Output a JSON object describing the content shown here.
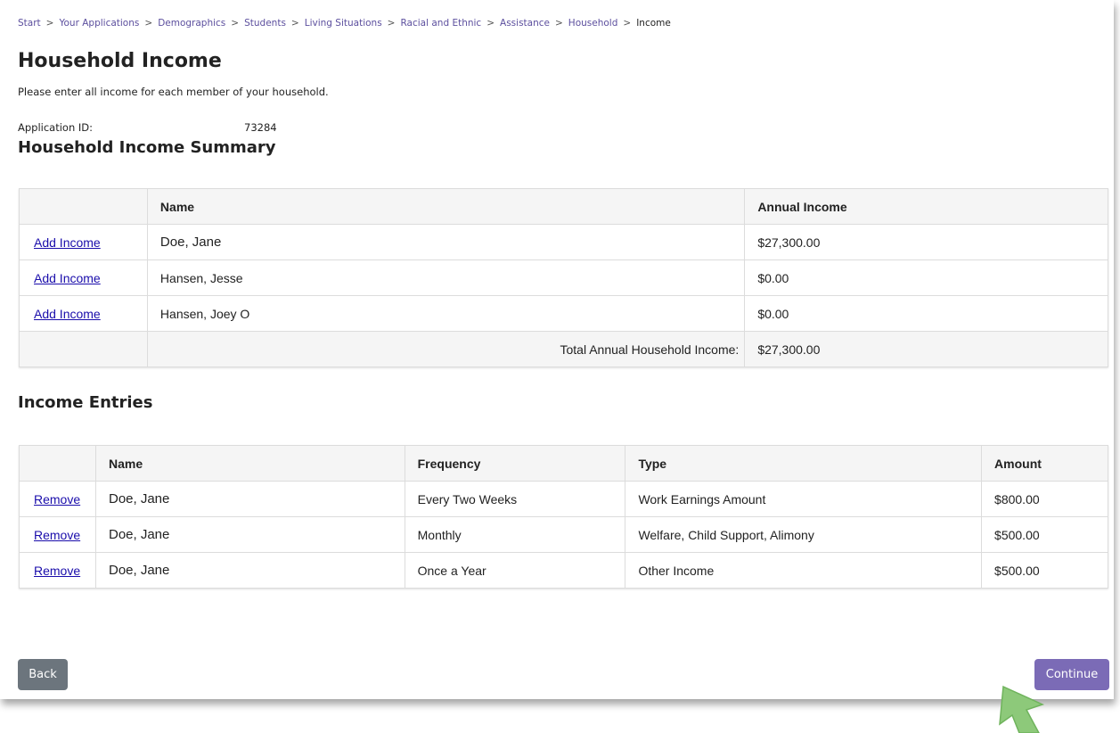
{
  "breadcrumb": {
    "items": [
      "Start",
      "Your Applications",
      "Demographics",
      "Students",
      "Living Situations",
      "Racial and Ethnic",
      "Assistance",
      "Household"
    ],
    "current": "Income",
    "separator": ">"
  },
  "header": {
    "title": "Household Income",
    "instructions": "Please enter all income for each member of your household."
  },
  "application": {
    "id_label": "Application ID:",
    "id_value": "73284"
  },
  "summary": {
    "title": "Household Income Summary",
    "columns": {
      "name": "Name",
      "income": "Annual Income"
    },
    "rows": [
      {
        "action": "Add Income",
        "name": "Doe, Jane",
        "income": "$27,300.00"
      },
      {
        "action": "Add Income",
        "name": "Hansen, Jesse",
        "income": "$0.00"
      },
      {
        "action": "Add Income",
        "name": "Hansen, Joey O",
        "income": "$0.00"
      }
    ],
    "total_label": "Total Annual Household Income:",
    "total_value": "$27,300.00"
  },
  "entries": {
    "title": "Income Entries",
    "columns": {
      "name": "Name",
      "frequency": "Frequency",
      "type": "Type",
      "amount": "Amount"
    },
    "rows": [
      {
        "action": "Remove",
        "name": "Doe, Jane",
        "frequency": "Every Two Weeks",
        "type": "Work Earnings Amount",
        "amount": "$800.00"
      },
      {
        "action": "Remove",
        "name": "Doe, Jane",
        "frequency": "Monthly",
        "type": "Welfare, Child Support, Alimony",
        "amount": "$500.00"
      },
      {
        "action": "Remove",
        "name": "Doe, Jane",
        "frequency": "Once a Year",
        "type": "Other Income",
        "amount": "$500.00"
      }
    ]
  },
  "buttons": {
    "back": "Back",
    "continue": "Continue"
  },
  "colors": {
    "link": "#1a0dab",
    "breadcrumb_link": "#5c4f9e",
    "continue_button": "#7b6bb6",
    "back_button": "#6c757d",
    "annotation_arrow": "#8dc97a"
  },
  "icons": {
    "annotation": "arrow-up-left-icon"
  }
}
